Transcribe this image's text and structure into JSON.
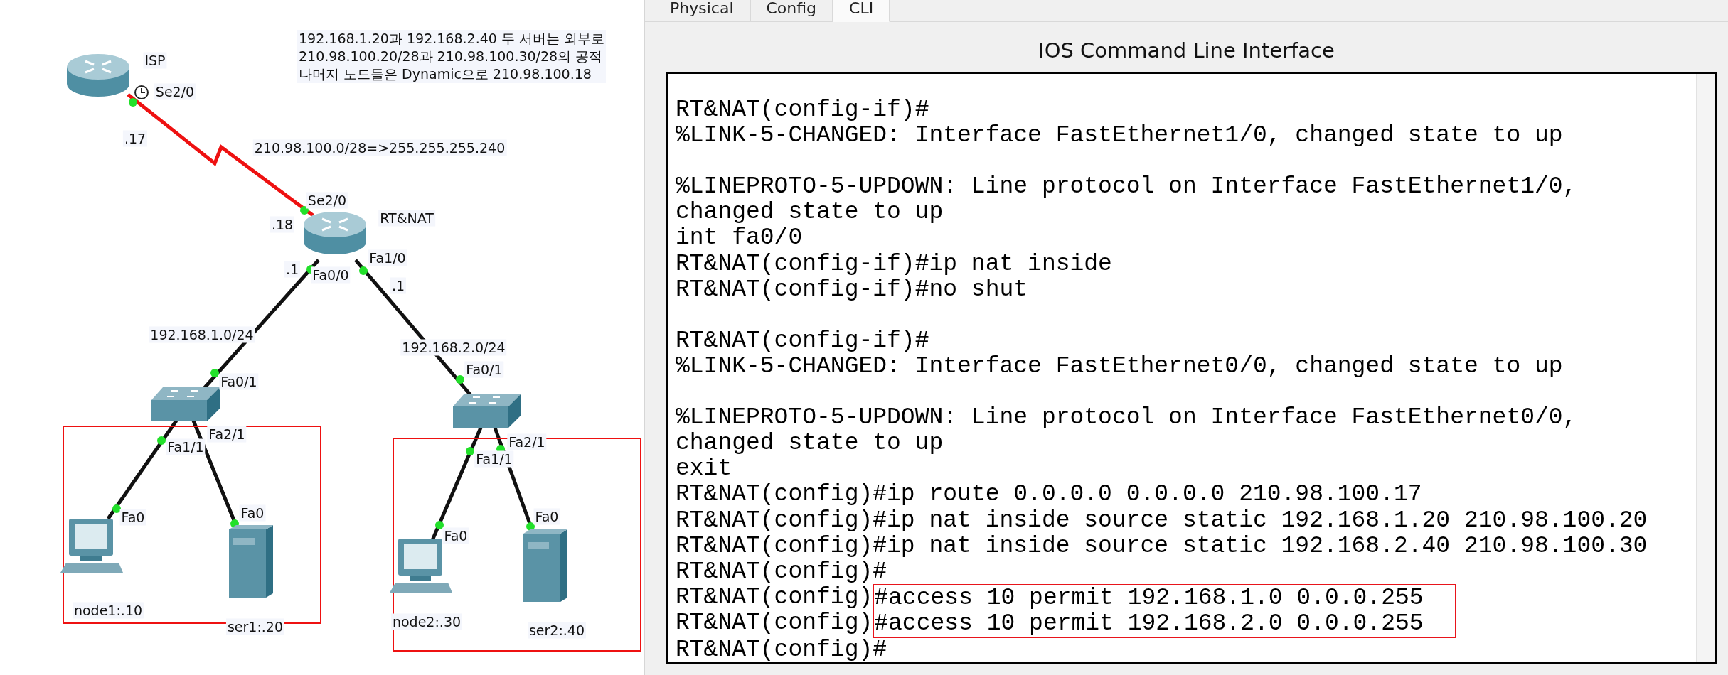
{
  "canvas": {
    "notes": [
      "192.168.1.20과 192.168.2.40 두 서버는 외부로",
      "210.98.100.20/28과 210.98.100.30/28의 공적",
      "나머지 노드들은 Dynamic으로 210.98.100.18"
    ],
    "devices": [
      {
        "kind": "router",
        "label": "ISP"
      },
      {
        "kind": "router",
        "label": "RT&NAT"
      },
      {
        "kind": "switch"
      },
      {
        "kind": "switch"
      },
      {
        "kind": "pc",
        "label": "node1:.10"
      },
      {
        "kind": "server",
        "label": "ser1:.20"
      },
      {
        "kind": "pc",
        "label": "node2:.30"
      },
      {
        "kind": "server",
        "label": "ser2:.40"
      }
    ],
    "links": [
      {
        "kind": "serial"
      },
      {
        "kind": "ethernet"
      },
      {
        "kind": "ethernet"
      },
      {
        "kind": "ethernet"
      },
      {
        "kind": "ethernet"
      },
      {
        "kind": "ethernet"
      },
      {
        "kind": "ethernet"
      }
    ],
    "labels": [
      "Se2/0",
      ".17",
      "210.98.100.0/28=>255.255.255.240",
      "Se2/0",
      ".18",
      ".1",
      "Fa0/0",
      "Fa1/0",
      ".1",
      "192.168.1.0/24",
      "192.168.2.0/24",
      "Fa0/1",
      "Fa0/1",
      "Fa1/1",
      "Fa2/1",
      "Fa1/1",
      "Fa2/1",
      "Fa0",
      "Fa0",
      "Fa0",
      "Fa0"
    ]
  },
  "panel": {
    "tabs": [
      {
        "label": "Physical",
        "selected": false
      },
      {
        "label": "Config",
        "selected": false
      },
      {
        "label": "CLI",
        "selected": true
      }
    ],
    "title": "IOS Command Line Interface",
    "terminal": {
      "blocks": [
        [
          {
            "text": "RT&NAT(config-if)#",
            "highlighted": false
          },
          {
            "text": "%LINK-5-CHANGED: Interface FastEthernet1/0, changed state to up",
            "highlighted": false
          }
        ],
        [
          {
            "text": "%LINEPROTO-5-UPDOWN: Line protocol on Interface FastEthernet1/0,",
            "highlighted": false
          },
          {
            "text": "changed state to up",
            "highlighted": false
          },
          {
            "text": "int fa0/0",
            "highlighted": false
          },
          {
            "text": "RT&NAT(config-if)#ip nat inside",
            "highlighted": false
          },
          {
            "text": "RT&NAT(config-if)#no shut",
            "highlighted": false
          }
        ],
        [
          {
            "text": "RT&NAT(config-if)#",
            "highlighted": false
          },
          {
            "text": "%LINK-5-CHANGED: Interface FastEthernet0/0, changed state to up",
            "highlighted": false
          }
        ],
        [
          {
            "text": "%LINEPROTO-5-UPDOWN: Line protocol on Interface FastEthernet0/0,",
            "highlighted": false
          },
          {
            "text": "changed state to up",
            "highlighted": false
          },
          {
            "text": "exit",
            "highlighted": false
          },
          {
            "text": "RT&NAT(config)#ip route 0.0.0.0 0.0.0.0 210.98.100.17",
            "highlighted": false
          },
          {
            "text": "RT&NAT(config)#ip nat inside source static 192.168.1.20 210.98.100.20",
            "highlighted": false
          },
          {
            "text": "RT&NAT(config)#ip nat inside source static 192.168.2.40 210.98.100.30",
            "highlighted": false
          },
          {
            "text": "RT&NAT(config)#",
            "highlighted": false
          },
          {
            "prompt": "RT&NAT(config)",
            "text": "#access 10 permit 192.168.1.0 0.0.0.255",
            "highlighted": true
          },
          {
            "prompt": "RT&NAT(config)",
            "text": "#access 10 permit 192.168.2.0 0.0.0.255",
            "highlighted": true
          },
          {
            "text": "RT&NAT(config)#",
            "highlighted": false
          }
        ]
      ]
    }
  }
}
